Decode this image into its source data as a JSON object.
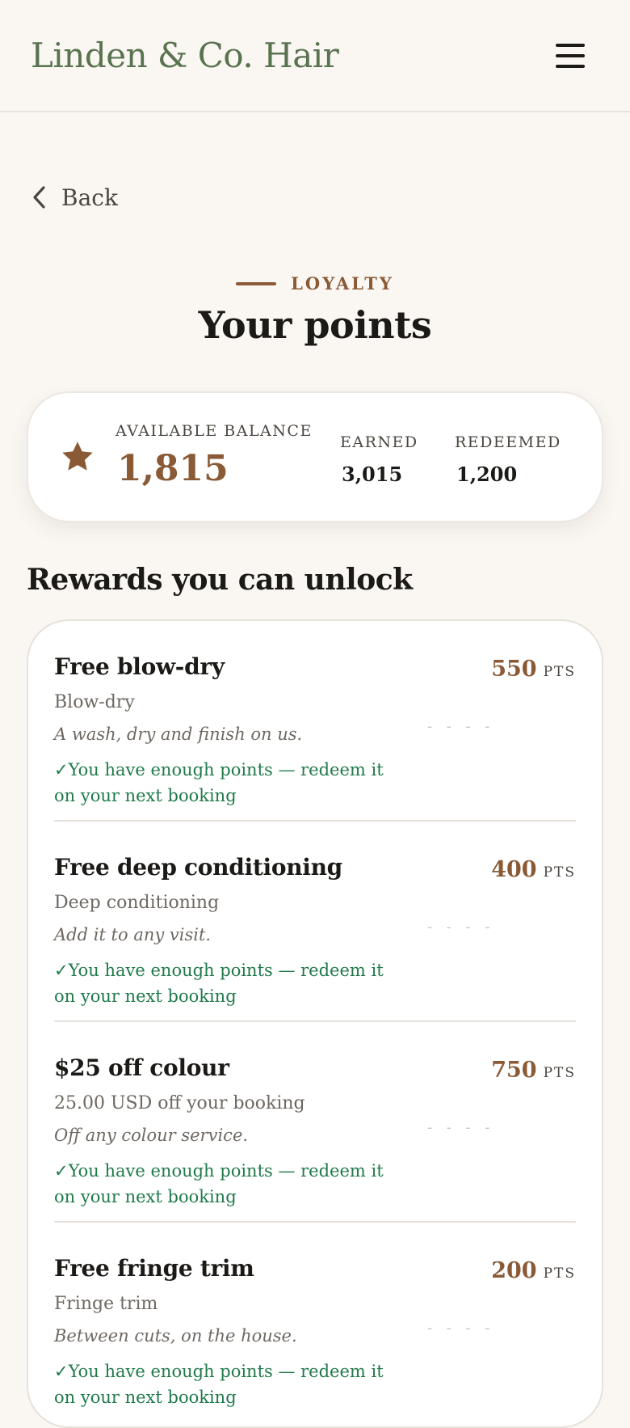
{
  "header": {
    "brand": "Linden & Co. Hair",
    "menu_icon": "hamburger-menu-icon"
  },
  "nav": {
    "back_label": "Back",
    "back_icon": "chevron-left-icon"
  },
  "page": {
    "eyebrow": "LOYALTY",
    "title": "Your points"
  },
  "balance": {
    "icon": "star-icon",
    "label": "AVAILABLE BALANCE",
    "value": "1,815",
    "earned_label": "EARNED",
    "earned_value": "3,015",
    "redeemed_label": "REDEEMED",
    "redeemed_value": "1,200"
  },
  "rewards": {
    "section_title": "Rewards you can unlock",
    "unit": "PTS",
    "placeholder": "- - - -",
    "items": [
      {
        "name": "Free blow-dry",
        "service": "Blow-dry",
        "description": "A wash, dry and finish on us.",
        "status": "✓You have enough points — redeem it on your next booking",
        "points": "550"
      },
      {
        "name": "Free deep conditioning",
        "service": "Deep conditioning",
        "description": "Add it to any visit.",
        "status": "✓You have enough points — redeem it on your next booking",
        "points": "400"
      },
      {
        "name": "$25 off colour",
        "service": "25.00 USD off your booking",
        "description": "Off any colour service.",
        "status": "✓You have enough points — redeem it on your next booking",
        "points": "750"
      },
      {
        "name": "Free fringe trim",
        "service": "Fringe trim",
        "description": "Between cuts, on the house.",
        "status": "✓You have enough points — redeem it on your next booking",
        "points": "200"
      }
    ]
  },
  "colors": {
    "brand_green": "#5a734f",
    "accent_brown": "#8a5a36",
    "success_green": "#1f7a4a",
    "background": "#faf7f3"
  }
}
